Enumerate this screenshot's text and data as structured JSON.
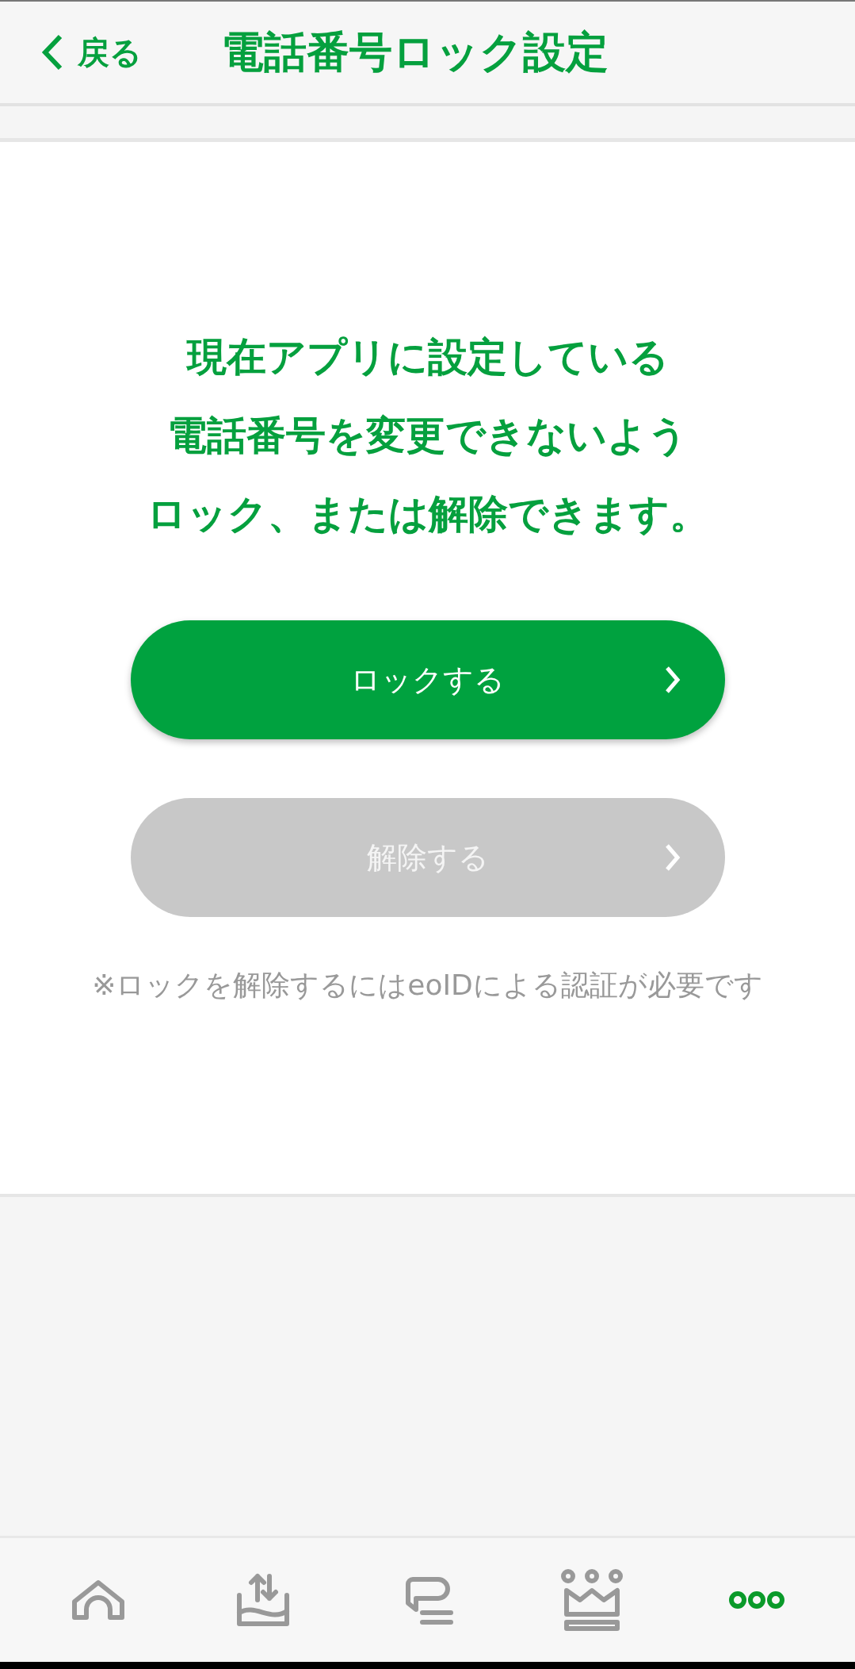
{
  "header": {
    "back_label": "戻る",
    "title": "電話番号ロック設定"
  },
  "message": [
    "現在アプリに設定している",
    "電話番号を変更できないよう",
    "ロック、または解除できます。"
  ],
  "buttons": [
    {
      "label": "ロックする",
      "disabled": false
    },
    {
      "label": "解除する",
      "disabled": true
    }
  ],
  "note": "※ロックを解除するにはeoIDによる認証が必要です",
  "nav": [
    {
      "kind": "home",
      "selected": false
    },
    {
      "kind": "transfer",
      "selected": false
    },
    {
      "kind": "chat",
      "selected": false
    },
    {
      "kind": "crown",
      "selected": false
    },
    {
      "kind": "more",
      "selected": true
    }
  ]
}
